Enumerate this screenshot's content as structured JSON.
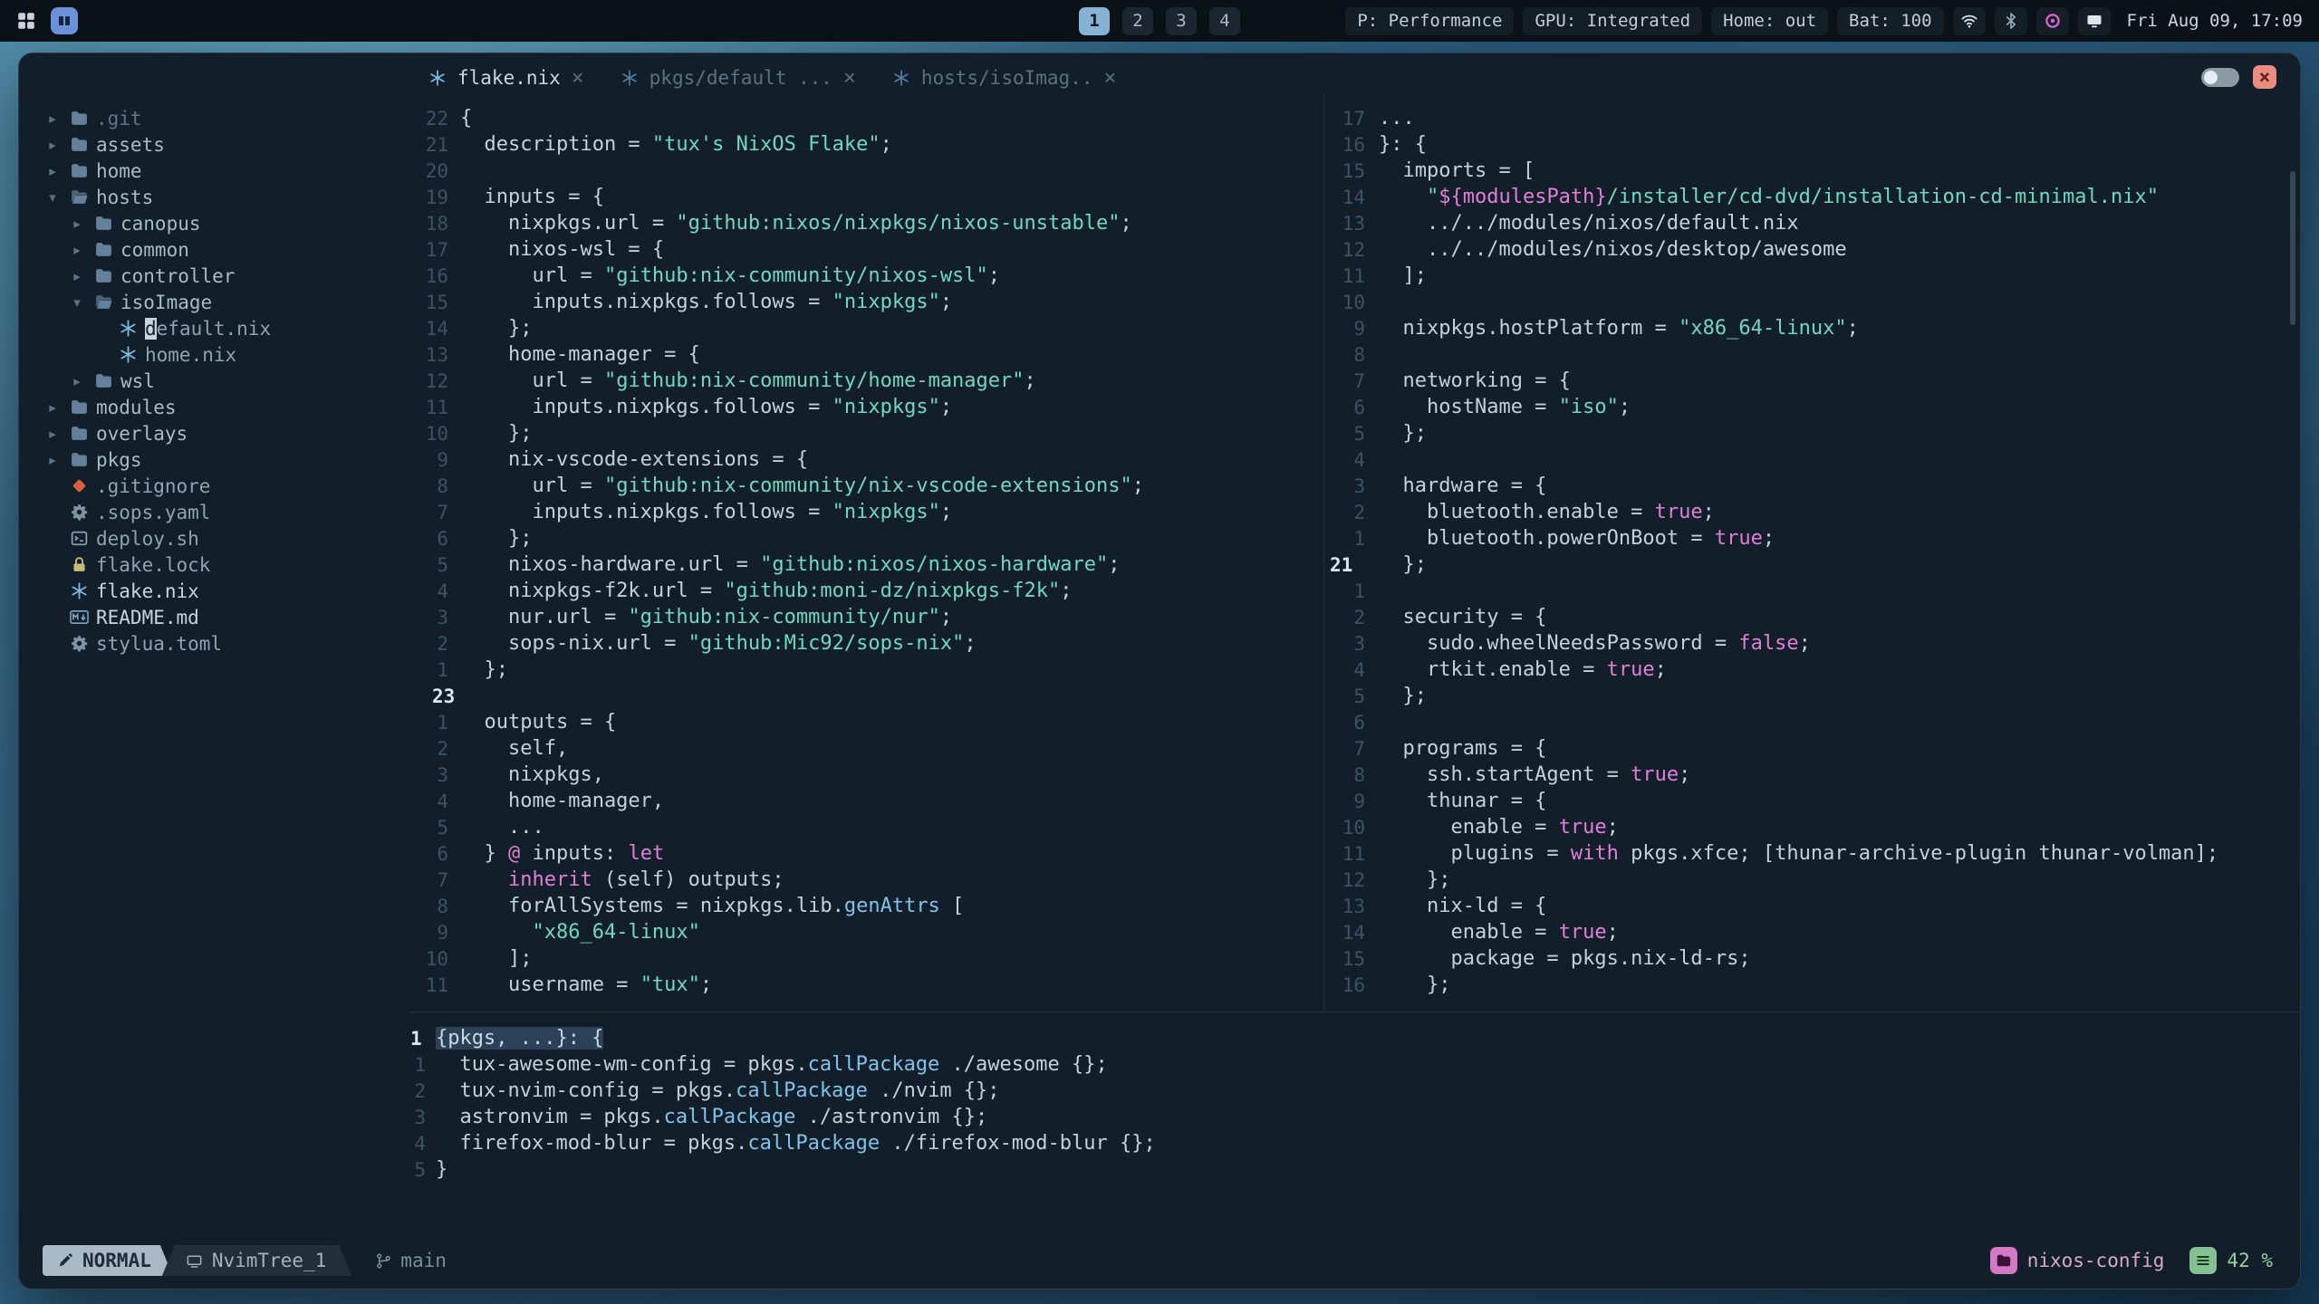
{
  "palette": {
    "accent_blue": "#7ebae4",
    "string_teal": "#6fd8bd",
    "keyword_pink": "#e07fd4",
    "function_blue": "#7fc2ea",
    "close_red": "#ea8d81",
    "project_pink": "#d477c4",
    "scroll_green": "#83c290",
    "workspace_active": "#86b2d3"
  },
  "top_bar": {
    "workspaces": {
      "items": [
        "1",
        "2",
        "3",
        "4"
      ],
      "active": "1"
    },
    "status_items": [
      "P: Performance",
      "GPU: Integrated",
      "Home: out",
      "Bat: 100"
    ],
    "icons": [
      "wifi",
      "bluetooth",
      "record",
      "screen"
    ],
    "clock": "Fri Aug 09, 17:09"
  },
  "tab_bar": {
    "tabs": [
      {
        "label": "flake.nix",
        "icon": "nix",
        "active": true
      },
      {
        "label": "pkgs/default ...",
        "icon": "nix",
        "active": false
      },
      {
        "label": "hosts/isoImag..",
        "icon": "nix",
        "active": false
      }
    ]
  },
  "tree": {
    "items": [
      {
        "level": 0,
        "state": "closed",
        "icon": "folder",
        "label": ".git",
        "tone": "dim"
      },
      {
        "level": 0,
        "state": "closed",
        "icon": "folder",
        "label": "assets"
      },
      {
        "level": 0,
        "state": "closed",
        "icon": "folder",
        "label": "home"
      },
      {
        "level": 0,
        "state": "open",
        "icon": "folder-open",
        "label": "hosts"
      },
      {
        "level": 1,
        "state": "closed",
        "icon": "folder",
        "label": "canopus"
      },
      {
        "level": 1,
        "state": "closed",
        "icon": "folder",
        "label": "common"
      },
      {
        "level": 1,
        "state": "closed",
        "icon": "folder",
        "label": "controller"
      },
      {
        "level": 1,
        "state": "open",
        "icon": "folder-open",
        "label": "isoImage"
      },
      {
        "level": 2,
        "icon": "nix",
        "label": "default.nix",
        "cursor": true
      },
      {
        "level": 2,
        "icon": "nix",
        "label": "home.nix"
      },
      {
        "level": 1,
        "state": "closed",
        "icon": "folder",
        "label": "wsl"
      },
      {
        "level": 0,
        "state": "closed",
        "icon": "folder",
        "label": "modules"
      },
      {
        "level": 0,
        "state": "closed",
        "icon": "folder",
        "label": "overlays"
      },
      {
        "level": 0,
        "state": "closed",
        "icon": "folder",
        "label": "pkgs"
      },
      {
        "level": 0,
        "icon": "git",
        "label": ".gitignore"
      },
      {
        "level": 0,
        "icon": "gear",
        "label": ".sops.yaml"
      },
      {
        "level": 0,
        "icon": "script",
        "label": "deploy.sh"
      },
      {
        "level": 0,
        "icon": "lock",
        "label": "flake.lock"
      },
      {
        "level": 0,
        "icon": "nix",
        "label": "flake.nix",
        "tone": "bright"
      },
      {
        "level": 0,
        "icon": "markdown",
        "label": "README.md",
        "tone": "bright"
      },
      {
        "level": 0,
        "icon": "gear",
        "label": "stylua.toml"
      }
    ]
  },
  "left_editor": {
    "lines": [
      {
        "n": "22",
        "t": [
          [
            "f",
            "{"
          ]
        ]
      },
      {
        "n": "21",
        "t": [
          [
            "f",
            "  description = "
          ],
          [
            "s",
            "\"tux's NixOS Flake\""
          ],
          [
            "f",
            ";"
          ]
        ]
      },
      {
        "n": "20",
        "t": []
      },
      {
        "n": "19",
        "t": [
          [
            "f",
            "  inputs = {"
          ]
        ]
      },
      {
        "n": "18",
        "t": [
          [
            "f",
            "    nixpkgs.url = "
          ],
          [
            "s",
            "\"github:nixos/nixpkgs/nixos-unstable\""
          ],
          [
            "f",
            ";"
          ]
        ]
      },
      {
        "n": "17",
        "t": [
          [
            "f",
            "    nixos-wsl = {"
          ]
        ]
      },
      {
        "n": "16",
        "t": [
          [
            "f",
            "      url = "
          ],
          [
            "s",
            "\"github:nix-community/nixos-wsl\""
          ],
          [
            "f",
            ";"
          ]
        ]
      },
      {
        "n": "15",
        "t": [
          [
            "f",
            "      inputs.nixpkgs.follows = "
          ],
          [
            "s",
            "\"nixpkgs\""
          ],
          [
            "f",
            ";"
          ]
        ]
      },
      {
        "n": "14",
        "t": [
          [
            "f",
            "    };"
          ]
        ]
      },
      {
        "n": "13",
        "t": [
          [
            "f",
            "    home-manager = {"
          ]
        ]
      },
      {
        "n": "12",
        "t": [
          [
            "f",
            "      url = "
          ],
          [
            "s",
            "\"github:nix-community/home-manager\""
          ],
          [
            "f",
            ";"
          ]
        ]
      },
      {
        "n": "11",
        "t": [
          [
            "f",
            "      inputs.nixpkgs.follows = "
          ],
          [
            "s",
            "\"nixpkgs\""
          ],
          [
            "f",
            ";"
          ]
        ]
      },
      {
        "n": "10",
        "t": [
          [
            "f",
            "    };"
          ]
        ]
      },
      {
        "n": "9",
        "t": [
          [
            "f",
            "    nix-vscode-extensions = {"
          ]
        ]
      },
      {
        "n": "8",
        "t": [
          [
            "f",
            "      url = "
          ],
          [
            "s",
            "\"github:nix-community/nix-vscode-extensions\""
          ],
          [
            "f",
            ";"
          ]
        ]
      },
      {
        "n": "7",
        "t": [
          [
            "f",
            "      inputs.nixpkgs.follows = "
          ],
          [
            "s",
            "\"nixpkgs\""
          ],
          [
            "f",
            ";"
          ]
        ]
      },
      {
        "n": "6",
        "t": [
          [
            "f",
            "    };"
          ]
        ]
      },
      {
        "n": "5",
        "t": [
          [
            "f",
            "    nixos-hardware.url = "
          ],
          [
            "s",
            "\"github:nixos/nixos-hardware\""
          ],
          [
            "f",
            ";"
          ]
        ]
      },
      {
        "n": "4",
        "t": [
          [
            "f",
            "    nixpkgs-f2k.url = "
          ],
          [
            "s",
            "\"github:moni-dz/nixpkgs-f2k\""
          ],
          [
            "f",
            ";"
          ]
        ]
      },
      {
        "n": "3",
        "t": [
          [
            "f",
            "    nur.url = "
          ],
          [
            "s",
            "\"github:nix-community/nur\""
          ],
          [
            "f",
            ";"
          ]
        ]
      },
      {
        "n": "2",
        "t": [
          [
            "f",
            "    sops-nix.url = "
          ],
          [
            "s",
            "\"github:Mic92/sops-nix\""
          ],
          [
            "f",
            ";"
          ]
        ]
      },
      {
        "n": "1",
        "t": [
          [
            "f",
            "  };"
          ]
        ]
      },
      {
        "n": "23",
        "cur": true,
        "t": []
      },
      {
        "n": "1",
        "t": [
          [
            "f",
            "  outputs = {"
          ]
        ]
      },
      {
        "n": "2",
        "t": [
          [
            "f",
            "    self,"
          ]
        ]
      },
      {
        "n": "3",
        "t": [
          [
            "f",
            "    nixpkgs,"
          ]
        ]
      },
      {
        "n": "4",
        "t": [
          [
            "f",
            "    home-manager,"
          ]
        ]
      },
      {
        "n": "5",
        "t": [
          [
            "f",
            "    ..."
          ]
        ]
      },
      {
        "n": "6",
        "t": [
          [
            "f",
            "  } "
          ],
          [
            "k",
            "@"
          ],
          [
            "f",
            " inputs: "
          ],
          [
            "k",
            "let"
          ]
        ]
      },
      {
        "n": "7",
        "t": [
          [
            "f",
            "    "
          ],
          [
            "k",
            "inherit"
          ],
          [
            "f",
            " (self) outputs;"
          ]
        ]
      },
      {
        "n": "8",
        "t": [
          [
            "f",
            "    forAllSystems = nixpkgs.lib."
          ],
          [
            "b",
            "genAttrs"
          ],
          [
            "f",
            " ["
          ]
        ]
      },
      {
        "n": "9",
        "t": [
          [
            "f",
            "      "
          ],
          [
            "s",
            "\"x86_64-linux\""
          ]
        ]
      },
      {
        "n": "10",
        "t": [
          [
            "f",
            "    ];"
          ]
        ]
      },
      {
        "n": "11",
        "t": [
          [
            "f",
            "    username = "
          ],
          [
            "s",
            "\"tux\""
          ],
          [
            "f",
            ";"
          ]
        ]
      }
    ]
  },
  "right_editor": {
    "lines": [
      {
        "n": "17",
        "t": [
          [
            "f",
            "..."
          ]
        ]
      },
      {
        "n": "16",
        "t": [
          [
            "f",
            "}: {"
          ]
        ]
      },
      {
        "n": "15",
        "t": [
          [
            "f",
            "  imports = ["
          ]
        ]
      },
      {
        "n": "14",
        "t": [
          [
            "f",
            "    "
          ],
          [
            "s",
            "\""
          ],
          [
            "k",
            "${modulesPath}"
          ],
          [
            "s",
            "/installer/cd-dvd/installation-cd-minimal.nix\""
          ]
        ]
      },
      {
        "n": "13",
        "t": [
          [
            "f",
            "    ../../modules/nixos/default.nix"
          ]
        ]
      },
      {
        "n": "12",
        "t": [
          [
            "f",
            "    ../../modules/nixos/desktop/awesome"
          ]
        ]
      },
      {
        "n": "11",
        "t": [
          [
            "f",
            "  ];"
          ]
        ]
      },
      {
        "n": "10",
        "t": []
      },
      {
        "n": "9",
        "t": [
          [
            "f",
            "  nixpkgs.hostPlatform = "
          ],
          [
            "s",
            "\"x86_64-linux\""
          ],
          [
            "f",
            ";"
          ]
        ]
      },
      {
        "n": "8",
        "t": []
      },
      {
        "n": "7",
        "t": [
          [
            "f",
            "  networking = {"
          ]
        ]
      },
      {
        "n": "6",
        "t": [
          [
            "f",
            "    hostName = "
          ],
          [
            "s",
            "\"iso\""
          ],
          [
            "f",
            ";"
          ]
        ]
      },
      {
        "n": "5",
        "t": [
          [
            "f",
            "  };"
          ]
        ]
      },
      {
        "n": "4",
        "t": []
      },
      {
        "n": "3",
        "t": [
          [
            "f",
            "  hardware = {"
          ]
        ]
      },
      {
        "n": "2",
        "t": [
          [
            "f",
            "    bluetooth.enable = "
          ],
          [
            "k",
            "true"
          ],
          [
            "f",
            ";"
          ]
        ]
      },
      {
        "n": "1",
        "t": [
          [
            "f",
            "    bluetooth.powerOnBoot = "
          ],
          [
            "k",
            "true"
          ],
          [
            "f",
            ";"
          ]
        ]
      },
      {
        "n": "21",
        "cur": true,
        "t": [
          [
            "f",
            "  };"
          ]
        ]
      },
      {
        "n": "1",
        "t": []
      },
      {
        "n": "2",
        "t": [
          [
            "f",
            "  security = {"
          ]
        ]
      },
      {
        "n": "3",
        "t": [
          [
            "f",
            "    sudo.wheelNeedsPassword = "
          ],
          [
            "k",
            "false"
          ],
          [
            "f",
            ";"
          ]
        ]
      },
      {
        "n": "4",
        "t": [
          [
            "f",
            "    rtkit.enable = "
          ],
          [
            "k",
            "true"
          ],
          [
            "f",
            ";"
          ]
        ]
      },
      {
        "n": "5",
        "t": [
          [
            "f",
            "  };"
          ]
        ]
      },
      {
        "n": "6",
        "t": []
      },
      {
        "n": "7",
        "t": [
          [
            "f",
            "  programs = {"
          ]
        ]
      },
      {
        "n": "8",
        "t": [
          [
            "f",
            "    ssh.startAgent = "
          ],
          [
            "k",
            "true"
          ],
          [
            "f",
            ";"
          ]
        ]
      },
      {
        "n": "9",
        "t": [
          [
            "f",
            "    thunar = {"
          ]
        ]
      },
      {
        "n": "10",
        "t": [
          [
            "f",
            "      enable = "
          ],
          [
            "k",
            "true"
          ],
          [
            "f",
            ";"
          ]
        ]
      },
      {
        "n": "11",
        "t": [
          [
            "f",
            "      plugins = "
          ],
          [
            "k",
            "with"
          ],
          [
            "f",
            " pkgs.xfce; [thunar-archive-plugin thunar-volman];"
          ]
        ]
      },
      {
        "n": "12",
        "t": [
          [
            "f",
            "    };"
          ]
        ]
      },
      {
        "n": "13",
        "t": [
          [
            "f",
            "    nix-ld = {"
          ]
        ]
      },
      {
        "n": "14",
        "t": [
          [
            "f",
            "      enable = "
          ],
          [
            "k",
            "true"
          ],
          [
            "f",
            ";"
          ]
        ]
      },
      {
        "n": "15",
        "t": [
          [
            "f",
            "      package = pkgs.nix-ld-rs;"
          ]
        ]
      },
      {
        "n": "16",
        "t": [
          [
            "f",
            "    };"
          ]
        ]
      }
    ]
  },
  "bottom_editor": {
    "lines": [
      {
        "n": "1",
        "cur": true,
        "t": [
          [
            "v",
            "{pkgs, ...}: {"
          ]
        ]
      },
      {
        "n": "1",
        "t": [
          [
            "f",
            "  tux-awesome-wm-config = pkgs."
          ],
          [
            "b",
            "callPackage"
          ],
          [
            "f",
            " ./awesome {};"
          ]
        ]
      },
      {
        "n": "2",
        "t": [
          [
            "f",
            "  tux-nvim-config = pkgs."
          ],
          [
            "b",
            "callPackage"
          ],
          [
            "f",
            " ./nvim {};"
          ]
        ]
      },
      {
        "n": "3",
        "t": [
          [
            "f",
            "  astronvim = pkgs."
          ],
          [
            "b",
            "callPackage"
          ],
          [
            "f",
            " ./astronvim {};"
          ]
        ]
      },
      {
        "n": "4",
        "t": [
          [
            "f",
            "  firefox-mod-blur = pkgs."
          ],
          [
            "b",
            "callPackage"
          ],
          [
            "f",
            " ./firefox-mod-blur {};"
          ]
        ]
      },
      {
        "n": "5",
        "t": [
          [
            "f",
            "}"
          ]
        ]
      }
    ]
  },
  "status_line": {
    "mode": "NORMAL",
    "buffer": "NvimTree_1",
    "branch": "main",
    "project": "nixos-config",
    "scroll": "42 %"
  }
}
